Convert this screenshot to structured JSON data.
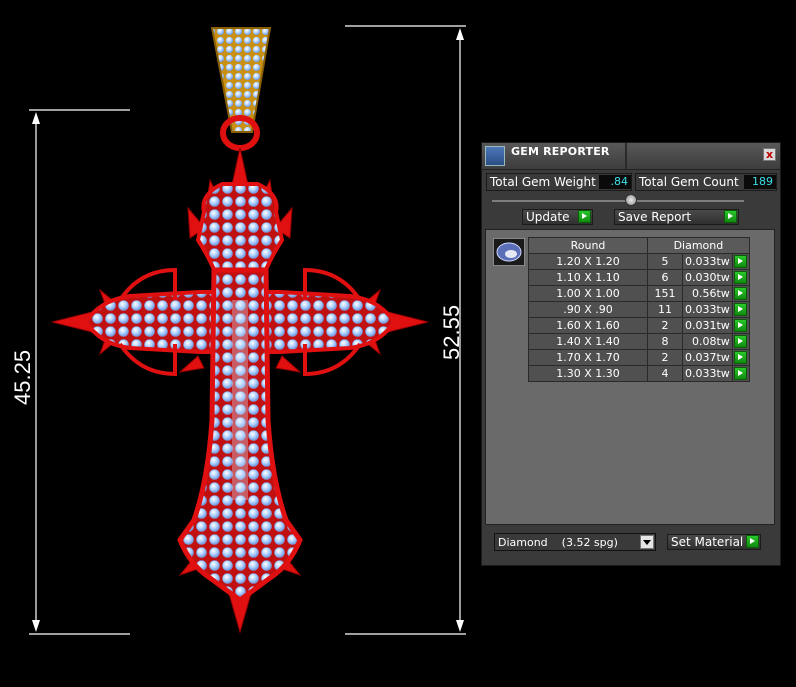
{
  "viewport": {
    "dimension_left": "45.25",
    "dimension_right": "52.55"
  },
  "gem_reporter": {
    "title": "GEM REPORTER",
    "close_label": "x",
    "total_weight_label": "Total Gem Weight",
    "total_weight_value": ".84",
    "total_count_label": "Total Gem Count",
    "total_count_value": "189",
    "update_label": "Update",
    "save_report_label": "Save Report",
    "table": {
      "shape_header": "Round",
      "material_header": "Diamond",
      "rows": [
        {
          "size": "1.20 X 1.20",
          "count": "5",
          "tw": "0.033tw"
        },
        {
          "size": "1.10 X 1.10",
          "count": "6",
          "tw": "0.030tw"
        },
        {
          "size": "1.00 X 1.00",
          "count": "151",
          "tw": "0.56tw"
        },
        {
          "size": ".90 X .90",
          "count": "11",
          "tw": "0.033tw"
        },
        {
          "size": "1.60 X 1.60",
          "count": "2",
          "tw": "0.031tw"
        },
        {
          "size": "1.40 X 1.40",
          "count": "8",
          "tw": "0.08tw"
        },
        {
          "size": "1.70 X 1.70",
          "count": "2",
          "tw": "0.037tw"
        },
        {
          "size": "1.30 X 1.30",
          "count": "4",
          "tw": "0.033tw"
        }
      ]
    },
    "material_select_value": "Diamond    (3.52 spg)",
    "set_material_label": "Set Material"
  },
  "colors": {
    "metal_red": "#e01010",
    "gem_blue": "#a8ccff",
    "bail_gold": "#d8a418",
    "value_cyan": "#39e0e6",
    "go_green": "#1aa81a"
  }
}
